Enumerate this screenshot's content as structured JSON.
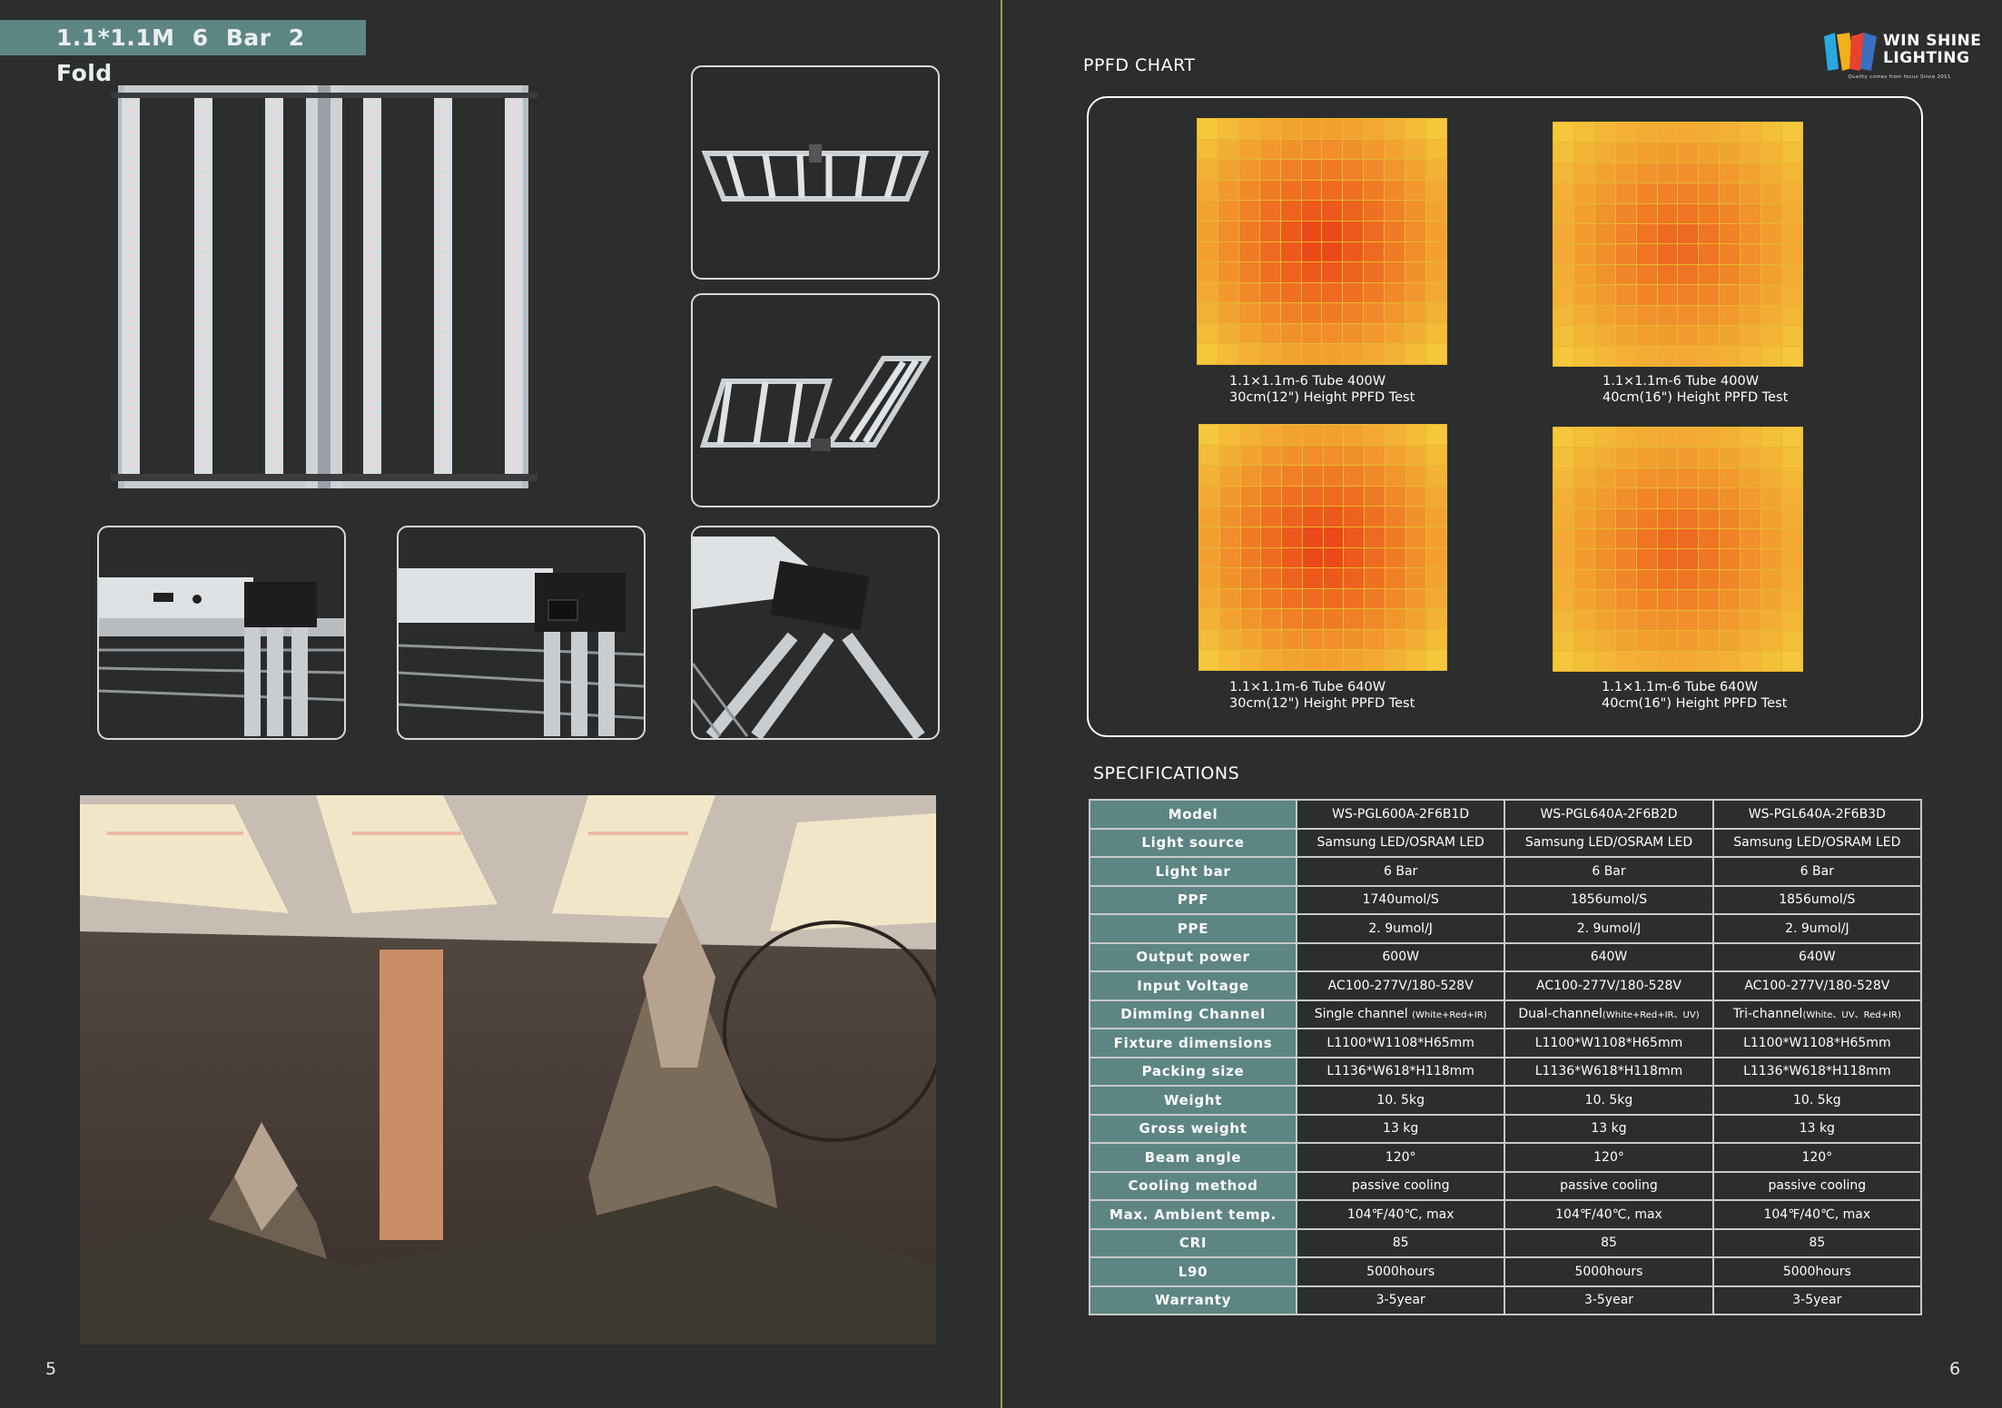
{
  "left_page": {
    "title": "1.1*1.1M  6 Bar  2 Fold",
    "page_number": "5"
  },
  "right_page": {
    "page_number": "6",
    "logo": {
      "line1": "WIN SHINE",
      "line2": "LIGHTING",
      "tagline": "Quality comes from focus  Since 2011"
    },
    "ppfd_title": "PPFD CHART",
    "charts": [
      {
        "caption1": "1.1×1.1m-6 Tube  400W",
        "caption2": "30cm(12\") Height PPFD Test"
      },
      {
        "caption1": "1.1×1.1m-6 Tube   400W",
        "caption2": "40cm(16\") Height PPFD Test"
      },
      {
        "caption1": "1.1×1.1m-6 Tube  640W",
        "caption2": "30cm(12\") Height PPFD Test"
      },
      {
        "caption1": "1.1×1.1m-6 Tube 640W",
        "caption2": "40cm(16\") Height PPFD Test"
      }
    ],
    "spec_title": "SPECIFICATIONS",
    "specs": {
      "rows": [
        {
          "label": "Model",
          "values": [
            "WS-PGL600A-2F6B1D",
            "WS-PGL640A-2F6B2D",
            "WS-PGL640A-2F6B3D"
          ]
        },
        {
          "label": "Light source",
          "values": [
            "Samsung LED/OSRAM LED",
            "Samsung LED/OSRAM LED",
            "Samsung LED/OSRAM LED"
          ]
        },
        {
          "label": "Light bar",
          "values": [
            "6 Bar",
            "6 Bar",
            "6 Bar"
          ]
        },
        {
          "label": "PPF",
          "values": [
            "1740umol/S",
            "1856umol/S",
            "1856umol/S"
          ]
        },
        {
          "label": "PPE",
          "values": [
            "2. 9umol/J",
            "2. 9umol/J",
            "2. 9umol/J"
          ]
        },
        {
          "label": "Output power",
          "values": [
            "600W",
            "640W",
            "640W"
          ]
        },
        {
          "label": "Input Voltage",
          "values": [
            "AC100-277V/180-528V",
            "AC100-277V/180-528V",
            "AC100-277V/180-528V"
          ]
        },
        {
          "label": "Dimming Channel",
          "main": [
            "Single channel ",
            "Dual-channel",
            "Tri-channel"
          ],
          "sub": [
            "(White+Red+IR)",
            "(White+Red+IR、UV)",
            "(White、UV、Red+IR)"
          ]
        },
        {
          "label": "Fixture dimensions",
          "values": [
            "L1100*W1108*H65mm",
            "L1100*W1108*H65mm",
            "L1100*W1108*H65mm"
          ]
        },
        {
          "label": "Packing size",
          "values": [
            "L1136*W618*H118mm",
            "L1136*W618*H118mm",
            "L1136*W618*H118mm"
          ]
        },
        {
          "label": "Weight",
          "values": [
            "10. 5kg",
            "10. 5kg",
            "10. 5kg"
          ]
        },
        {
          "label": "Gross weight",
          "values": [
            "13 kg",
            "13 kg",
            "13 kg"
          ]
        },
        {
          "label": "Beam angle",
          "values": [
            "120°",
            "120°",
            "120°"
          ]
        },
        {
          "label": "Cooling method",
          "values": [
            "passive cooling",
            "passive cooling",
            "passive cooling"
          ]
        },
        {
          "label": "Max. Ambient temp.",
          "values": [
            "104℉/40℃, max",
            "104℉/40℃, max",
            "104℉/40℃, max"
          ]
        },
        {
          "label": "CRI",
          "values": [
            "85",
            "85",
            "85"
          ]
        },
        {
          "label": "L90",
          "values": [
            "5000hours",
            "5000hours",
            "5000hours"
          ]
        },
        {
          "label": "Warranty",
          "values": [
            "3-5year",
            "3-5year",
            "3-5year"
          ]
        }
      ]
    }
  },
  "colors": {
    "accent_teal": "#5d8583",
    "background": "#2c2d2d",
    "divider": "#a39a4a"
  }
}
